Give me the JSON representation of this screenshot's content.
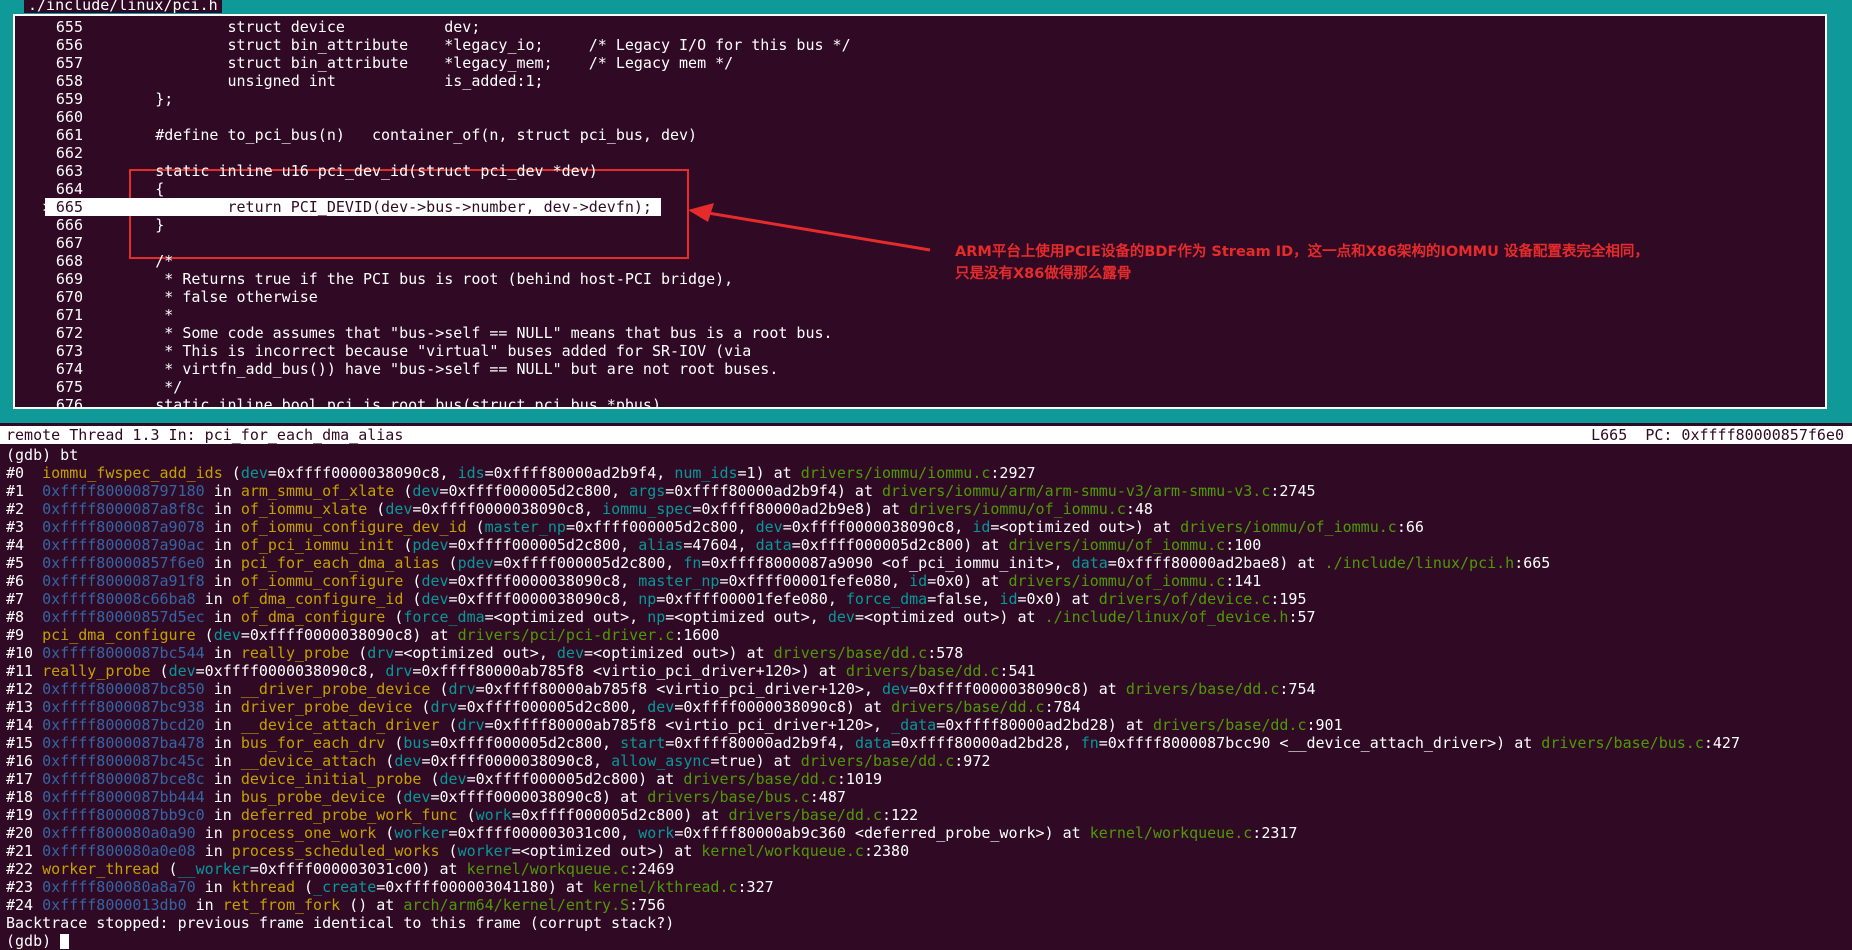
{
  "source": {
    "file_title": "./include/linux/pci.h",
    "lines": [
      {
        "no": "655",
        "text": "                struct device           dev;"
      },
      {
        "no": "656",
        "text": "                struct bin_attribute    *legacy_io;     /* Legacy I/O for this bus */"
      },
      {
        "no": "657",
        "text": "                struct bin_attribute    *legacy_mem;    /* Legacy mem */"
      },
      {
        "no": "658",
        "text": "                unsigned int            is_added:1;"
      },
      {
        "no": "659",
        "text": "        };"
      },
      {
        "no": "660",
        "text": ""
      },
      {
        "no": "661",
        "text": "        #define to_pci_bus(n)   container_of(n, struct pci_bus, dev)"
      },
      {
        "no": "662",
        "text": ""
      },
      {
        "no": "663",
        "text": "        static inline u16 pci_dev_id(struct pci_dev *dev)"
      },
      {
        "no": "664",
        "text": "        {"
      },
      {
        "no": "665",
        "text": "                return PCI_DEVID(dev->bus->number, dev->devfn);",
        "current": true
      },
      {
        "no": "666",
        "text": "        }"
      },
      {
        "no": "667",
        "text": ""
      },
      {
        "no": "668",
        "text": "        /*"
      },
      {
        "no": "669",
        "text": "         * Returns true if the PCI bus is root (behind host-PCI bridge),"
      },
      {
        "no": "670",
        "text": "         * false otherwise"
      },
      {
        "no": "671",
        "text": "         *"
      },
      {
        "no": "672",
        "text": "         * Some code assumes that \"bus->self == NULL\" means that bus is a root bus."
      },
      {
        "no": "673",
        "text": "         * This is incorrect because \"virtual\" buses added for SR-IOV (via"
      },
      {
        "no": "674",
        "text": "         * virtfn_add_bus()) have \"bus->self == NULL\" but are not root buses."
      },
      {
        "no": "675",
        "text": "         */"
      },
      {
        "no": "676",
        "text": "        static inline bool pci_is_root_bus(struct pci_bus *pbus)"
      }
    ],
    "current_marker": ">"
  },
  "annotation": {
    "line1": "ARM平台上使用PCIE设备的BDF作为 Stream ID，这一点和X86架构的IOMMU 设备配置表完全相同，",
    "line2": "只是没有X86做得那么露骨",
    "color": "#e52b2b"
  },
  "status_bar": {
    "left": "remote Thread 1.3 In: pci_for_each_dma_alias",
    "line": "L665",
    "pc": "PC: 0xffff80000857f6e0"
  },
  "gdb": {
    "command_line": "(gdb) bt",
    "frames": [
      [
        [
          "#0  ",
          ""
        ],
        [
          "iommu_fwspec_add_ids",
          "fn"
        ],
        [
          " (",
          ""
        ],
        [
          "dev",
          "arg"
        ],
        [
          "=0xffff0000038090c8, ",
          ""
        ],
        [
          "ids",
          "arg"
        ],
        [
          "=0xffff80000ad2b9f4, ",
          ""
        ],
        [
          "num_ids",
          "arg"
        ],
        [
          "=1) at ",
          ""
        ],
        [
          "drivers/iommu/iommu.c",
          "file"
        ],
        [
          ":2927",
          ""
        ]
      ],
      [
        [
          "#1  ",
          ""
        ],
        [
          "0xffff800008797180",
          "addr"
        ],
        [
          " in ",
          ""
        ],
        [
          "arm_smmu_of_xlate",
          "fn"
        ],
        [
          " (",
          ""
        ],
        [
          "dev",
          "arg"
        ],
        [
          "=0xffff000005d2c800, ",
          ""
        ],
        [
          "args",
          "arg"
        ],
        [
          "=0xffff80000ad2b9f4) at ",
          ""
        ],
        [
          "drivers/iommu/arm/arm-smmu-v3/arm-smmu-v3.c",
          "file"
        ],
        [
          ":2745",
          ""
        ]
      ],
      [
        [
          "#2  ",
          ""
        ],
        [
          "0xffff8000087a8f8c",
          "addr"
        ],
        [
          " in ",
          ""
        ],
        [
          "of_iommu_xlate",
          "fn"
        ],
        [
          " (",
          ""
        ],
        [
          "dev",
          "arg"
        ],
        [
          "=0xffff0000038090c8, ",
          ""
        ],
        [
          "iommu_spec",
          "arg"
        ],
        [
          "=0xffff80000ad2b9e8) at ",
          ""
        ],
        [
          "drivers/iommu/of_iommu.c",
          "file"
        ],
        [
          ":48",
          ""
        ]
      ],
      [
        [
          "#3  ",
          ""
        ],
        [
          "0xffff8000087a9078",
          "addr"
        ],
        [
          " in ",
          ""
        ],
        [
          "of_iommu_configure_dev_id",
          "fn"
        ],
        [
          " (",
          ""
        ],
        [
          "master_np",
          "arg"
        ],
        [
          "=0xffff000005d2c800, ",
          ""
        ],
        [
          "dev",
          "arg"
        ],
        [
          "=0xffff0000038090c8, ",
          ""
        ],
        [
          "id",
          "arg"
        ],
        [
          "=<optimized out>) at ",
          ""
        ],
        [
          "drivers/iommu/of_iommu.c",
          "file"
        ],
        [
          ":66",
          ""
        ]
      ],
      [
        [
          "#4  ",
          ""
        ],
        [
          "0xffff8000087a90ac",
          "addr"
        ],
        [
          " in ",
          ""
        ],
        [
          "of_pci_iommu_init",
          "fn"
        ],
        [
          " (",
          ""
        ],
        [
          "pdev",
          "arg"
        ],
        [
          "=0xffff000005d2c800, ",
          ""
        ],
        [
          "alias",
          "arg"
        ],
        [
          "=47604, ",
          ""
        ],
        [
          "data",
          "arg"
        ],
        [
          "=0xffff000005d2c800) at ",
          ""
        ],
        [
          "drivers/iommu/of_iommu.c",
          "file"
        ],
        [
          ":100",
          ""
        ]
      ],
      [
        [
          "#5  ",
          ""
        ],
        [
          "0xffff80000857f6e0",
          "addr"
        ],
        [
          " in ",
          ""
        ],
        [
          "pci_for_each_dma_alias",
          "fn"
        ],
        [
          " (",
          ""
        ],
        [
          "pdev",
          "arg"
        ],
        [
          "=0xffff000005d2c800, ",
          ""
        ],
        [
          "fn",
          "arg"
        ],
        [
          "=0xffff8000087a9090 <of_pci_iommu_init>, ",
          ""
        ],
        [
          "data",
          "arg"
        ],
        [
          "=0xffff80000ad2bae8) at ",
          ""
        ],
        [
          "./include/linux/pci.h",
          "file"
        ],
        [
          ":665",
          ""
        ]
      ],
      [
        [
          "#6  ",
          ""
        ],
        [
          "0xffff8000087a91f8",
          "addr"
        ],
        [
          " in ",
          ""
        ],
        [
          "of_iommu_configure",
          "fn"
        ],
        [
          " (",
          ""
        ],
        [
          "dev",
          "arg"
        ],
        [
          "=0xffff0000038090c8, ",
          ""
        ],
        [
          "master_np",
          "arg"
        ],
        [
          "=0xffff00001fefe080, ",
          ""
        ],
        [
          "id",
          "arg"
        ],
        [
          "=0x0) at ",
          ""
        ],
        [
          "drivers/iommu/of_iommu.c",
          "file"
        ],
        [
          ":141",
          ""
        ]
      ],
      [
        [
          "#7  ",
          ""
        ],
        [
          "0xffff80008c66ba8",
          "addr"
        ],
        [
          " in ",
          ""
        ],
        [
          "of_dma_configure_id",
          "fn"
        ],
        [
          " (",
          ""
        ],
        [
          "dev",
          "arg"
        ],
        [
          "=0xffff0000038090c8, ",
          ""
        ],
        [
          "np",
          "arg"
        ],
        [
          "=0xffff00001fefe080, ",
          ""
        ],
        [
          "force_dma",
          "arg"
        ],
        [
          "=false, ",
          ""
        ],
        [
          "id",
          "arg"
        ],
        [
          "=0x0) at ",
          ""
        ],
        [
          "drivers/of/device.c",
          "file"
        ],
        [
          ":195",
          ""
        ]
      ],
      [
        [
          "#8  ",
          ""
        ],
        [
          "0xffff80000857d5ec",
          "addr"
        ],
        [
          " in ",
          ""
        ],
        [
          "of_dma_configure",
          "fn"
        ],
        [
          " (",
          ""
        ],
        [
          "force_dma",
          "arg"
        ],
        [
          "=<optimized out>, ",
          ""
        ],
        [
          "np",
          "arg"
        ],
        [
          "=<optimized out>, ",
          ""
        ],
        [
          "dev",
          "arg"
        ],
        [
          "=<optimized out>) at ",
          ""
        ],
        [
          "./include/linux/of_device.h",
          "file"
        ],
        [
          ":57",
          ""
        ]
      ],
      [
        [
          "#9  ",
          ""
        ],
        [
          "pci_dma_configure",
          "fn"
        ],
        [
          " (",
          ""
        ],
        [
          "dev",
          "arg"
        ],
        [
          "=0xffff0000038090c8) at ",
          ""
        ],
        [
          "drivers/pci/pci-driver.c",
          "file"
        ],
        [
          ":1600",
          ""
        ]
      ],
      [
        [
          "#10 ",
          ""
        ],
        [
          "0xffff8000087bc544",
          "addr"
        ],
        [
          " in ",
          ""
        ],
        [
          "really_probe",
          "fn"
        ],
        [
          " (",
          ""
        ],
        [
          "drv",
          "arg"
        ],
        [
          "=<optimized out>, ",
          ""
        ],
        [
          "dev",
          "arg"
        ],
        [
          "=<optimized out>) at ",
          ""
        ],
        [
          "drivers/base/dd.c",
          "file"
        ],
        [
          ":578",
          ""
        ]
      ],
      [
        [
          "#11 ",
          ""
        ],
        [
          "really_probe",
          "fn"
        ],
        [
          " (",
          ""
        ],
        [
          "dev",
          "arg"
        ],
        [
          "=0xffff0000038090c8, ",
          ""
        ],
        [
          "drv",
          "arg"
        ],
        [
          "=0xffff80000ab785f8 <virtio_pci_driver+120>) at ",
          ""
        ],
        [
          "drivers/base/dd.c",
          "file"
        ],
        [
          ":541",
          ""
        ]
      ],
      [
        [
          "#12 ",
          ""
        ],
        [
          "0xffff8000087bc850",
          "addr"
        ],
        [
          " in ",
          ""
        ],
        [
          "__driver_probe_device",
          "fn"
        ],
        [
          " (",
          ""
        ],
        [
          "drv",
          "arg"
        ],
        [
          "=0xffff80000ab785f8 <virtio_pci_driver+120>, ",
          ""
        ],
        [
          "dev",
          "arg"
        ],
        [
          "=0xffff0000038090c8) at ",
          ""
        ],
        [
          "drivers/base/dd.c",
          "file"
        ],
        [
          ":754",
          ""
        ]
      ],
      [
        [
          "#13 ",
          ""
        ],
        [
          "0xffff8000087bc938",
          "addr"
        ],
        [
          " in ",
          ""
        ],
        [
          "driver_probe_device",
          "fn"
        ],
        [
          " (",
          ""
        ],
        [
          "drv",
          "arg"
        ],
        [
          "=0xffff000005d2c800, ",
          ""
        ],
        [
          "dev",
          "arg"
        ],
        [
          "=0xffff0000038090c8) at ",
          ""
        ],
        [
          "drivers/base/dd.c",
          "file"
        ],
        [
          ":784",
          ""
        ]
      ],
      [
        [
          "#14 ",
          ""
        ],
        [
          "0xffff8000087bcd20",
          "addr"
        ],
        [
          " in ",
          ""
        ],
        [
          "__device_attach_driver",
          "fn"
        ],
        [
          " (",
          ""
        ],
        [
          "drv",
          "arg"
        ],
        [
          "=0xffff80000ab785f8 <virtio_pci_driver+120>, ",
          ""
        ],
        [
          "_data",
          "arg"
        ],
        [
          "=0xffff80000ad2bd28) at ",
          ""
        ],
        [
          "drivers/base/dd.c",
          "file"
        ],
        [
          ":901",
          ""
        ]
      ],
      [
        [
          "#15 ",
          ""
        ],
        [
          "0xffff8000087ba478",
          "addr"
        ],
        [
          " in ",
          ""
        ],
        [
          "bus_for_each_drv",
          "fn"
        ],
        [
          " (",
          ""
        ],
        [
          "bus",
          "arg"
        ],
        [
          "=0xffff000005d2c800, ",
          ""
        ],
        [
          "start",
          "arg"
        ],
        [
          "=0xffff80000ad2b9f4, ",
          ""
        ],
        [
          "data",
          "arg"
        ],
        [
          "=0xffff80000ad2bd28, ",
          ""
        ],
        [
          "fn",
          "arg"
        ],
        [
          "=0xffff8000087bcc90 <__device_attach_driver>) at ",
          ""
        ],
        [
          "drivers/base/bus.c",
          "file"
        ],
        [
          ":427",
          ""
        ]
      ],
      [
        [
          "#16 ",
          ""
        ],
        [
          "0xffff8000087bc45c",
          "addr"
        ],
        [
          " in ",
          ""
        ],
        [
          "__device_attach",
          "fn"
        ],
        [
          " (",
          ""
        ],
        [
          "dev",
          "arg"
        ],
        [
          "=0xffff0000038090c8, ",
          ""
        ],
        [
          "allow_async",
          "arg"
        ],
        [
          "=true) at ",
          ""
        ],
        [
          "drivers/base/dd.c",
          "file"
        ],
        [
          ":972",
          ""
        ]
      ],
      [
        [
          "#17 ",
          ""
        ],
        [
          "0xffff8000087bce8c",
          "addr"
        ],
        [
          " in ",
          ""
        ],
        [
          "device_initial_probe",
          "fn"
        ],
        [
          " (",
          ""
        ],
        [
          "dev",
          "arg"
        ],
        [
          "=0xffff000005d2c800) at ",
          ""
        ],
        [
          "drivers/base/dd.c",
          "file"
        ],
        [
          ":1019",
          ""
        ]
      ],
      [
        [
          "#18 ",
          ""
        ],
        [
          "0xffff8000087bb444",
          "addr"
        ],
        [
          " in ",
          ""
        ],
        [
          "bus_probe_device",
          "fn"
        ],
        [
          " (",
          ""
        ],
        [
          "dev",
          "arg"
        ],
        [
          "=0xffff0000038090c8) at ",
          ""
        ],
        [
          "drivers/base/bus.c",
          "file"
        ],
        [
          ":487",
          ""
        ]
      ],
      [
        [
          "#19 ",
          ""
        ],
        [
          "0xffff8000087bb9c0",
          "addr"
        ],
        [
          " in ",
          ""
        ],
        [
          "deferred_probe_work_func",
          "fn"
        ],
        [
          " (",
          ""
        ],
        [
          "work",
          "arg"
        ],
        [
          "=0xffff000005d2c800) at ",
          ""
        ],
        [
          "drivers/base/dd.c",
          "file"
        ],
        [
          ":122",
          ""
        ]
      ],
      [
        [
          "#20 ",
          ""
        ],
        [
          "0xffff800080a0a90",
          "addr"
        ],
        [
          " in ",
          ""
        ],
        [
          "process_one_work",
          "fn"
        ],
        [
          " (",
          ""
        ],
        [
          "worker",
          "arg"
        ],
        [
          "=0xffff000003031c00, ",
          ""
        ],
        [
          "work",
          "arg"
        ],
        [
          "=0xffff80000ab9c360 <deferred_probe_work>) at ",
          ""
        ],
        [
          "kernel/workqueue.c",
          "file"
        ],
        [
          ":2317",
          ""
        ]
      ],
      [
        [
          "#21 ",
          ""
        ],
        [
          "0xffff800080a0e08",
          "addr"
        ],
        [
          " in ",
          ""
        ],
        [
          "process_scheduled_works",
          "fn"
        ],
        [
          " (",
          ""
        ],
        [
          "worker",
          "arg"
        ],
        [
          "=<optimized out>) at ",
          ""
        ],
        [
          "kernel/workqueue.c",
          "file"
        ],
        [
          ":2380",
          ""
        ]
      ],
      [
        [
          "#22 ",
          ""
        ],
        [
          "worker_thread",
          "fn"
        ],
        [
          " (",
          ""
        ],
        [
          "__worker",
          "arg"
        ],
        [
          "=0xffff000003031c00) at ",
          ""
        ],
        [
          "kernel/workqueue.c",
          "file"
        ],
        [
          ":2469",
          ""
        ]
      ],
      [
        [
          "#23 ",
          ""
        ],
        [
          "0xffff800080a8a70",
          "addr"
        ],
        [
          " in ",
          ""
        ],
        [
          "kthread",
          "fn"
        ],
        [
          " (",
          ""
        ],
        [
          "_create",
          "arg"
        ],
        [
          "=0xffff000003041180) at ",
          ""
        ],
        [
          "kernel/kthread.c",
          "file"
        ],
        [
          ":327",
          ""
        ]
      ],
      [
        [
          "#24 ",
          ""
        ],
        [
          "0xffff8000013db0",
          "addr"
        ],
        [
          " in ",
          ""
        ],
        [
          "ret_from_fork",
          "fn"
        ],
        [
          " () at ",
          ""
        ],
        [
          "arch/arm64/kernel/entry.S",
          "file"
        ],
        [
          ":756",
          ""
        ]
      ]
    ],
    "backtrace_end": "Backtrace stopped: previous frame identical to this frame (corrupt stack?)",
    "prompt": "(gdb) "
  },
  "colors": {
    "background": "#300a24",
    "frame": "#0f9999",
    "function": "#c4a000",
    "address": "#3465a4",
    "argument": "#06989a",
    "file": "#4e9a06",
    "annotation": "#e52b2b"
  }
}
